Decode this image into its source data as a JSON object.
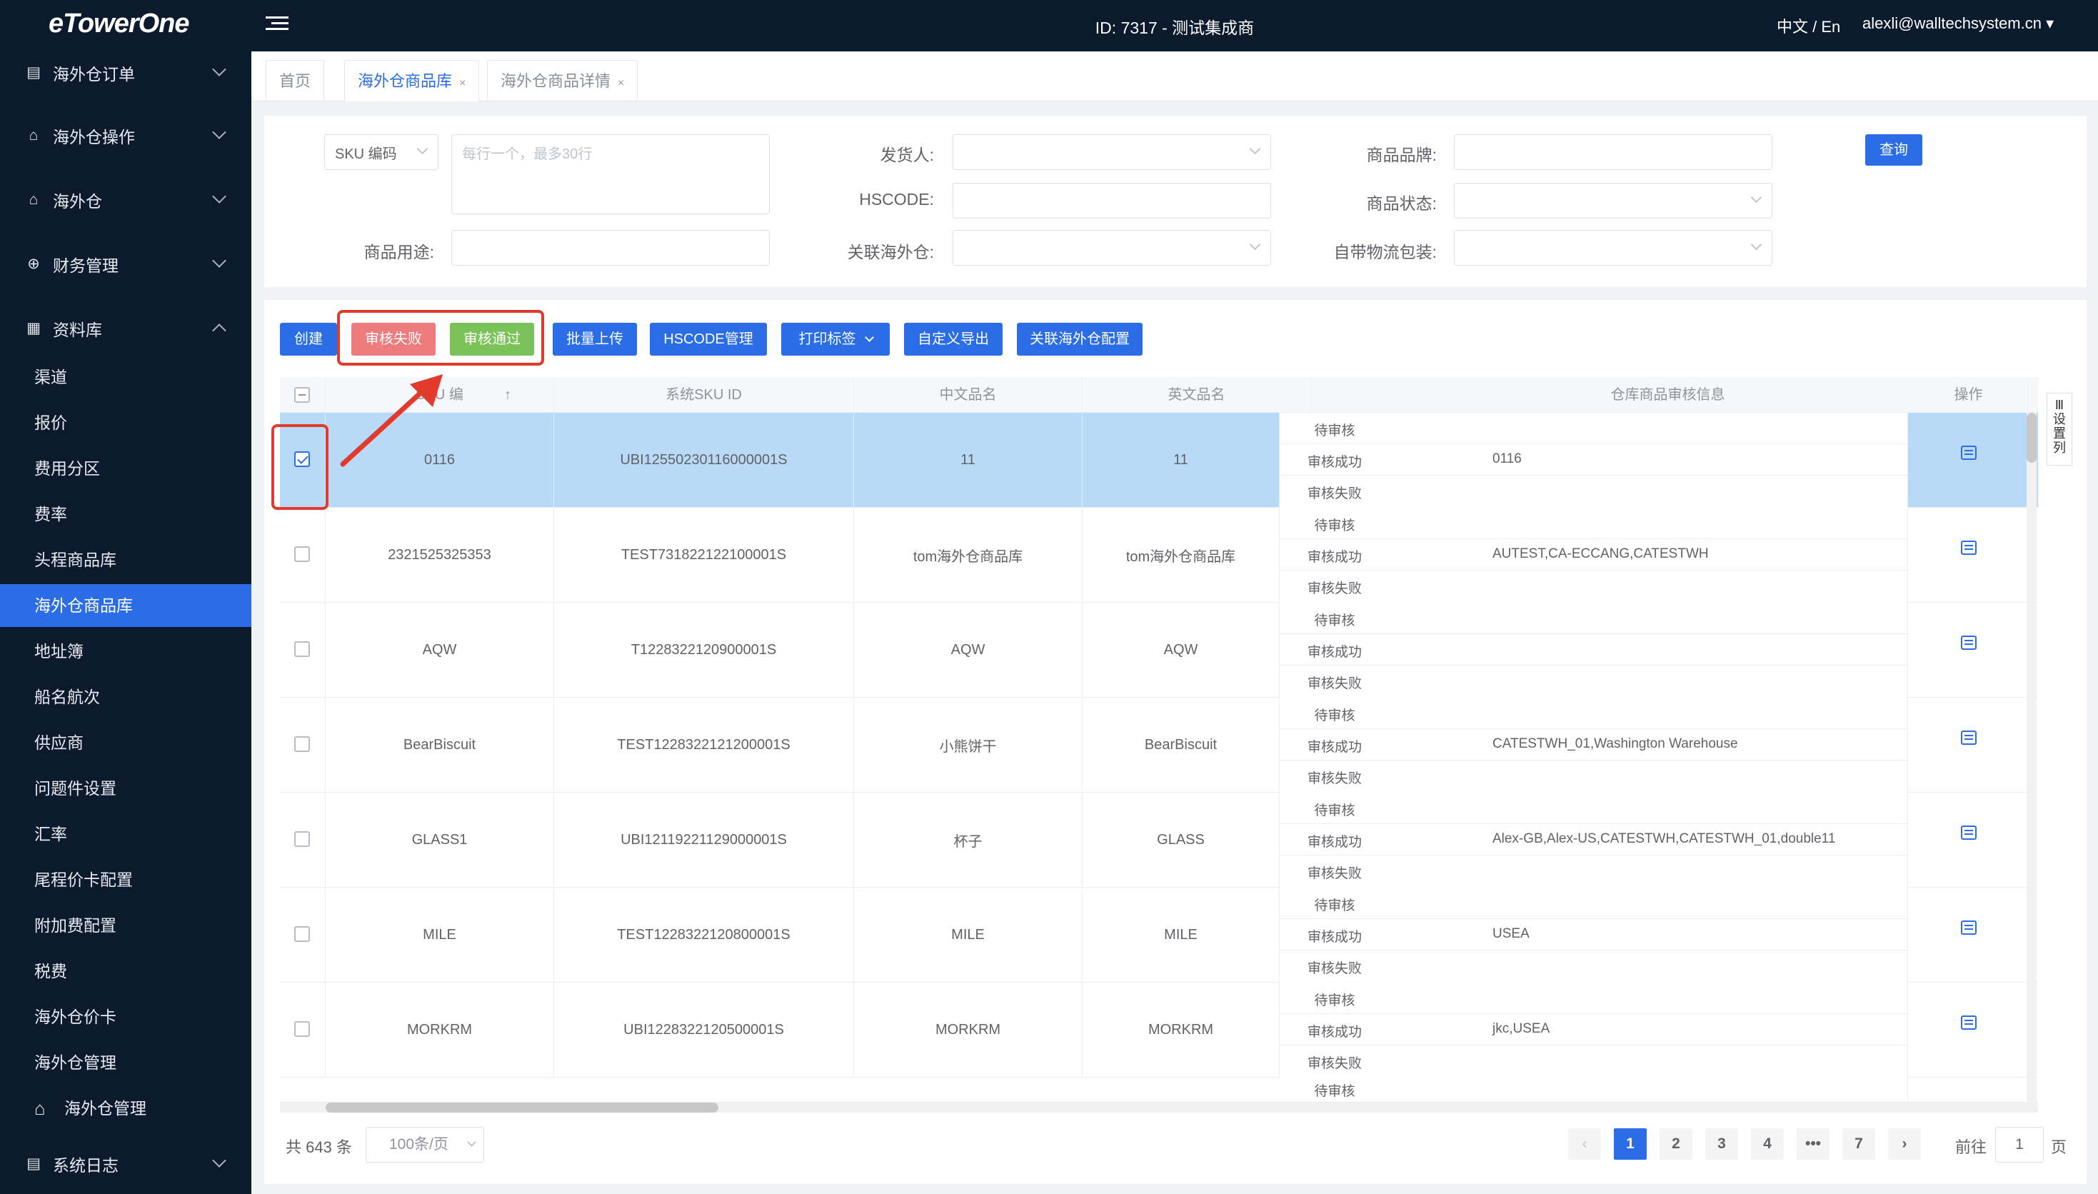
{
  "topbar": {
    "logo": "eTowerOne",
    "title": "ID: 7317 - 测试集成商",
    "lang": "中文 / En",
    "user": "alexli@walltechsystem.cn ▾"
  },
  "sidebar": {
    "groups": [
      {
        "label": "海外仓订单",
        "icon": "order-icon"
      },
      {
        "label": "海外仓操作",
        "icon": "operation-icon"
      },
      {
        "label": "海外仓",
        "icon": "warehouse-icon"
      },
      {
        "label": "财务管理",
        "icon": "finance-icon"
      },
      {
        "label": "资料库",
        "icon": "database-icon"
      }
    ],
    "sub_items": [
      "渠道",
      "报价",
      "费用分区",
      "费率",
      "头程商品库",
      "海外仓商品库",
      "地址簿",
      "船名航次",
      "供应商",
      "问题件设置",
      "汇率",
      "尾程价卡配置",
      "附加费配置",
      "税费",
      "海外仓价卡",
      "海外仓管理"
    ],
    "nested_item": "海外仓管理",
    "log": "系统日志"
  },
  "tabs": [
    {
      "label": "首页"
    },
    {
      "label": "海外仓商品库",
      "close": "×"
    },
    {
      "label": "海外仓商品详情",
      "close": "×"
    }
  ],
  "filter": {
    "sku_select": "SKU 编码",
    "sku_placeholder": "每行一个，最多30行",
    "shipper_label": "发货人:",
    "hscode_label": "HSCODE:",
    "linked_wh_label": "关联海外仓:",
    "brand_label": "商品品牌:",
    "status_label": "商品状态:",
    "packaging_label": "自带物流包装:",
    "usage_label": "商品用途:",
    "query": "查询"
  },
  "toolbar": {
    "create": "创建",
    "reject": "审核失败",
    "approve": "审核通过",
    "bulk_upload": "批量上传",
    "hscode": "HSCODE管理",
    "print": "打印标签",
    "export": "自定义导出",
    "linked": "关联海外仓配置"
  },
  "table": {
    "headers": {
      "sku": "SKU 编",
      "sort": "↑",
      "system_sku": "系统SKU ID",
      "cn_name": "中文品名",
      "en_name": "英文品名",
      "audit": "仓库商品审核信息",
      "action": "操作"
    },
    "audit_keys": {
      "pending": "待审核",
      "success": "审核成功",
      "failed": "审核失败"
    },
    "rows": [
      {
        "sku": "0116",
        "system_sku": "UBI12550230116000001S",
        "cn": "11",
        "en": "11",
        "success": "0116",
        "checked": true
      },
      {
        "sku": "2321525325353",
        "system_sku": "TEST731822122100001S",
        "cn": "tom海外仓商品库",
        "en": "tom海外仓商品库",
        "success": "AUTEST,CA-ECCANG,CATESTWH",
        "checked": false
      },
      {
        "sku": "AQW",
        "system_sku": "T1228322120900001S",
        "cn": "AQW",
        "en": "AQW",
        "success": "",
        "checked": false
      },
      {
        "sku": "BearBiscuit",
        "system_sku": "TEST1228322121200001S",
        "cn": "小熊饼干",
        "en": "BearBiscuit",
        "success": "CATESTWH_01,Washington Warehouse",
        "checked": false
      },
      {
        "sku": "GLASS1",
        "system_sku": "UBI12119221129000001S",
        "cn": "杯子",
        "en": "GLASS",
        "success": "Alex-GB,Alex-US,CATESTWH,CATESTWH_01,double11",
        "checked": false
      },
      {
        "sku": "MILE",
        "system_sku": "TEST1228322120800001S",
        "cn": "MILE",
        "en": "MILE",
        "success": "USEA",
        "checked": false
      },
      {
        "sku": "MORKRM",
        "system_sku": "UBI1228322120500001S",
        "cn": "MORKRM",
        "en": "MORKRM",
        "success": "jkc,USEA",
        "checked": false
      }
    ],
    "partial_row_label": "待审核",
    "settings_col": "设置列"
  },
  "pagination": {
    "total": "共 643 条",
    "page_size": "100条/页",
    "pages": [
      "1",
      "2",
      "3",
      "4",
      "•••",
      "7"
    ],
    "prev": "‹",
    "next": "›",
    "goto_prefix": "前往",
    "goto_value": "1",
    "goto_suffix": "页"
  },
  "colors": {
    "primary": "#2a6de6",
    "sidebar": "#0c1a2e",
    "reject": "#ef7c7c",
    "approve": "#7cc25a",
    "highlight": "#e23b2e",
    "selected_row": "#b9daf7"
  }
}
